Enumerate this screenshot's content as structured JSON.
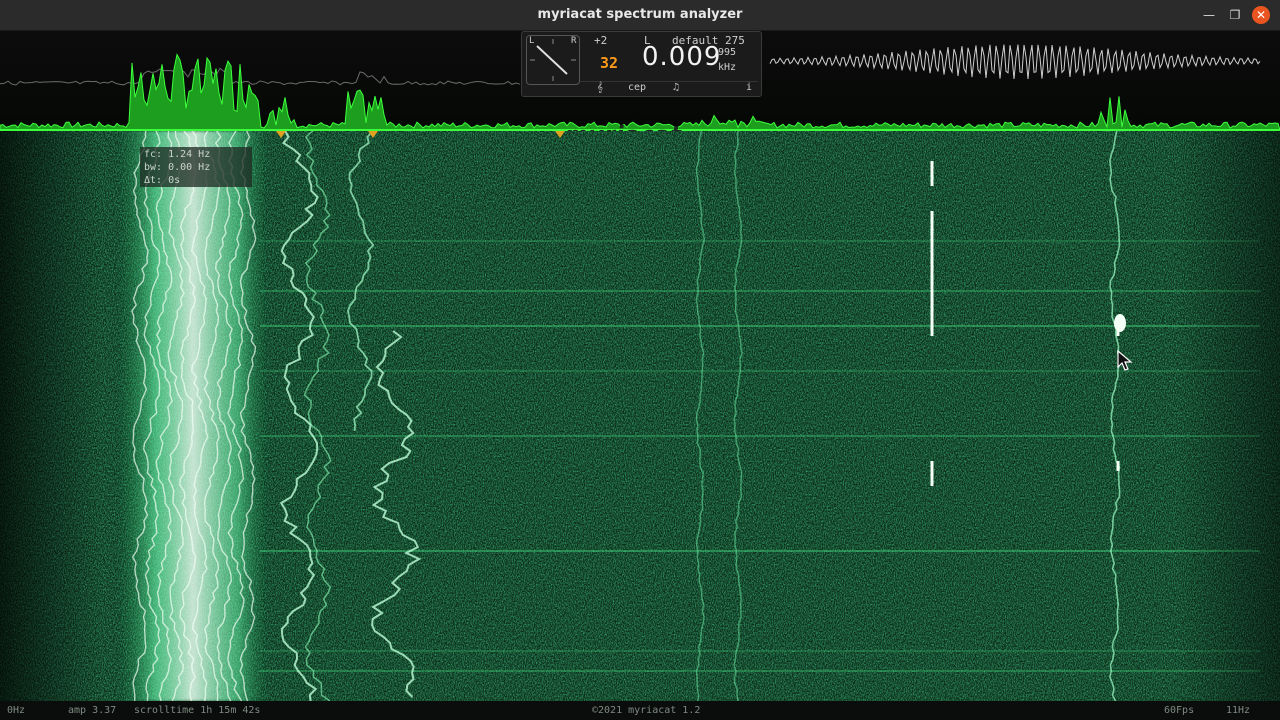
{
  "window": {
    "title": "myriacat spectrum analyzer"
  },
  "controls": {
    "minimize_icon": "minimize-icon",
    "maximize_icon": "maximize-icon",
    "close_icon": "close-icon"
  },
  "hud": {
    "gain": "+2",
    "channel": "L",
    "preset": "default",
    "fft_size": "275",
    "octave": "32",
    "frequency": "0.009",
    "frequency_fraction": "995",
    "unit": "kHz",
    "dial_l": "L",
    "dial_r": "R",
    "buttons": [
      "𝄞",
      "cep",
      "♫",
      "i"
    ]
  },
  "watermark": "myriacat",
  "readout": {
    "fc": "fc: 1.24 Hz",
    "bw": "bw: 0.00 Hz",
    "dt": "Δt: 0s"
  },
  "status": {
    "min_freq": "0Hz",
    "amp": "amp 3.37",
    "scrolltime": "scrolltime 1h 15m 42s",
    "copyright": "©2021 myriacat 1.2",
    "fps": "60Fps",
    "max_freq": "11Hz"
  },
  "colors": {
    "accent": "#3cff3c",
    "signal": "#e9ffe9",
    "background": "#0b2a16",
    "marker": "#e0a020",
    "close_button": "#e95420"
  }
}
